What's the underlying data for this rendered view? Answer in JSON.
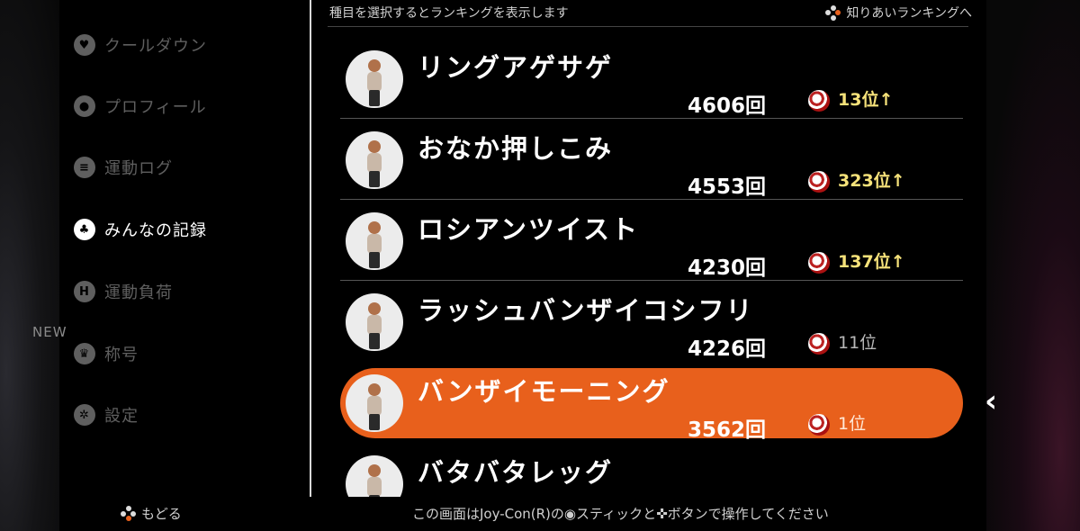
{
  "sidebar": {
    "new_badge": "NEW",
    "items": [
      {
        "label": "クールダウン",
        "icon": "cooldown-icon",
        "glyph": "♥"
      },
      {
        "label": "プロフィール",
        "icon": "profile-icon",
        "glyph": "●"
      },
      {
        "label": "運動ログ",
        "icon": "list-icon",
        "glyph": "≡"
      },
      {
        "label": "みんなの記録",
        "icon": "people-icon",
        "glyph": "♣"
      },
      {
        "label": "運動負荷",
        "icon": "load-icon",
        "glyph": "H"
      },
      {
        "label": "称号",
        "icon": "trophy-icon",
        "glyph": "♛"
      },
      {
        "label": "設定",
        "icon": "gear-icon",
        "glyph": "✲"
      }
    ],
    "active_index": 3
  },
  "header": {
    "instruction": "種目を選択するとランキングを表示します",
    "friend_link": "知りあいランキングへ"
  },
  "exercises": [
    {
      "name": "リングアゲサゲ",
      "count": "4606回",
      "rank": "13位",
      "arrow": "↑",
      "trend": "up"
    },
    {
      "name": "おなか押しこみ",
      "count": "4553回",
      "rank": "323位",
      "arrow": "↑",
      "trend": "up"
    },
    {
      "name": "ロシアンツイスト",
      "count": "4230回",
      "rank": "137位",
      "arrow": "↑",
      "trend": "up"
    },
    {
      "name": "ラッシュバンザイコシフリ",
      "count": "4226回",
      "rank": "11位",
      "arrow": "",
      "trend": "none"
    },
    {
      "name": "バンザイモーニング",
      "count": "3562回",
      "rank": "1位",
      "arrow": "",
      "trend": "none"
    },
    {
      "name": "バタバタレッグ",
      "count": "",
      "rank": "",
      "arrow": "",
      "trend": "none"
    }
  ],
  "selected_index": 4,
  "colors": {
    "accent": "#e8601c",
    "rank_up": "#f6e27a"
  },
  "footer": {
    "back_label": "もどる",
    "hint": "この画面はJoy-Con(R)の◉スティックと✜ボタンで操作してください"
  }
}
